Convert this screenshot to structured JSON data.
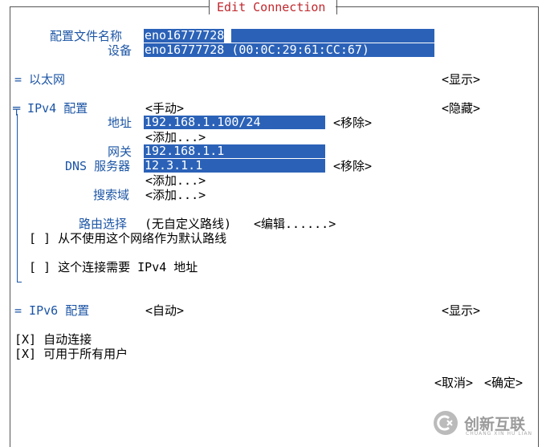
{
  "window": {
    "title": "Edit Connection"
  },
  "profile": {
    "name_label": "配置文件名称",
    "name_value": "eno16777728",
    "device_label": "设备",
    "device_value": "eno16777728 (00:0C:29:61:CC:67)"
  },
  "ethernet": {
    "label": "= 以太网",
    "toggle": "<显示>"
  },
  "ipv4": {
    "label": "╤ IPv4 配置",
    "method": "<手动>",
    "toggle": "<隐藏>",
    "address_label": "地址",
    "address_value": "192.168.1.100/24",
    "remove": "<移除>",
    "add_label": "<添加...>",
    "gateway_label": "网关",
    "gateway_value": "192.168.1.1",
    "dns_label": "DNS 服务器",
    "dns_value": "12.3.1.1",
    "search_label": "搜索域",
    "routing_label": "路由选择",
    "routing_value": "(无自定义路线)",
    "routing_edit": "<编辑......>",
    "never_default": "[ ] 从不使用这个网络作为默认路线",
    "require_ipv4": "[ ] 这个连接需要 IPv4 地址"
  },
  "ipv6": {
    "label": "= IPv6 配置",
    "method": "<自动>",
    "toggle": "<显示>"
  },
  "options": {
    "auto_connect": "[X] 自动连接",
    "all_users": "[X] 可用于所有用户"
  },
  "buttons": {
    "cancel": "<取消>",
    "ok": "<确定>"
  },
  "watermark": {
    "brand": "创新互联",
    "sub": "CHUANG XIN HU LIAN"
  }
}
